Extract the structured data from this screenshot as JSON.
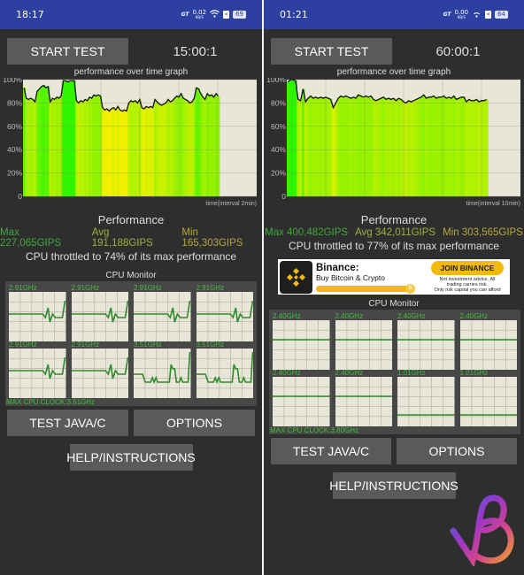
{
  "screens": [
    {
      "status": {
        "time": "18:17",
        "net_speed": "0.02",
        "net_unit": "KB/S",
        "battery": "69"
      },
      "start_label": "START TEST",
      "timer": "15:00:1",
      "graph": {
        "title": "performance over time graph",
        "y_ticks": [
          "100%",
          "80%",
          "60%",
          "40%",
          "20%",
          "0"
        ],
        "x_label": "time(interval 2min)"
      },
      "performance": {
        "title": "Performance",
        "max": "Max 227,065GIPS",
        "avg": "Avg 191,188GIPS",
        "min": "Min 165,303GIPS",
        "throttle": "CPU throttled to 74% of its max performance"
      },
      "cpu_monitor": {
        "title": "CPU Monitor",
        "cores": [
          "2.91GHz",
          "2.91GHz",
          "2.91GHz",
          "2.91GHz",
          "2.91GHz",
          "2.91GHz",
          "3.51GHz",
          "3.51GHz"
        ],
        "max_clock": "MAX CPU CLOCK:3.51GHz"
      },
      "buttons": {
        "test_java": "TEST JAVA/C",
        "options": "OPTIONS",
        "help": "HELP/INSTRUCTIONS"
      }
    },
    {
      "status": {
        "time": "01:21",
        "net_speed": "0.00",
        "net_unit": "KB/S",
        "battery": "64"
      },
      "start_label": "START TEST",
      "timer": "60:00:1",
      "graph": {
        "title": "performance over time graph",
        "y_ticks": [
          "100%",
          "80%",
          "60%",
          "40%",
          "20%",
          "0"
        ],
        "x_label": "time(interval 10min)"
      },
      "performance": {
        "title": "Performance",
        "max": "Max 400,482GIPS",
        "avg": "Avg 342,011GIPS",
        "min": "Min 303,565GIPS",
        "throttle": "CPU throttled to 77% of its max performance"
      },
      "ad": {
        "title": "Binance:",
        "subtitle": "Buy Bitcoin & Crypto",
        "cta": "JOIN BINANCE",
        "disclaimer_1": "Not investment advice. All",
        "disclaimer_2": "trading carries risk.",
        "disclaimer_3": "Only risk capital you can afford"
      },
      "cpu_monitor": {
        "title": "CPU Monitor",
        "cores": [
          "2.40GHz",
          "2.40GHz",
          "2.40GHz",
          "2.40GHz",
          "2.40GHz",
          "2.40GHz",
          "1.01GHz",
          "1.01GHz"
        ],
        "max_clock": "MAX CPU CLOCK:3.80GHz"
      },
      "buttons": {
        "test_java": "TEST JAVA/C",
        "options": "OPTIONS",
        "help": "HELP/INSTRUCTIONS"
      }
    }
  ],
  "colors": {
    "status_bar": "#2d3fa0",
    "background": "#2e2e2e",
    "button": "#5a5a5a",
    "max_green": "#3fa83a",
    "avg_green": "#9ab33a",
    "min_yellow": "#b5a843",
    "core_green": "#3fc03a",
    "ad_yellow": "#f0b90b"
  },
  "chart_data": [
    {
      "type": "area",
      "title": "performance over time graph",
      "xlabel": "time(interval 2min)",
      "ylabel": "",
      "ylim": [
        0,
        100
      ],
      "y_ticks": [
        0,
        20,
        40,
        60,
        80,
        100
      ],
      "x_range_fraction": 0.84,
      "series": [
        {
          "name": "performance %",
          "values": [
            93,
            84,
            83,
            84,
            83,
            81,
            90,
            92,
            94,
            95,
            93,
            94,
            81,
            84,
            83,
            85,
            84,
            86,
            99,
            99,
            98,
            99,
            99,
            99,
            82,
            80,
            82,
            81,
            83,
            82,
            85,
            84,
            87,
            86,
            87,
            86,
            76,
            74,
            75,
            73,
            75,
            76,
            74,
            77,
            74,
            73,
            74,
            73,
            80,
            82,
            81,
            82,
            80,
            83,
            76,
            75,
            77,
            76,
            77,
            76,
            83,
            81,
            79,
            78,
            79,
            80,
            83,
            81,
            82,
            84,
            86,
            85,
            88,
            84,
            83,
            82,
            80,
            81,
            84,
            93,
            92,
            88,
            85,
            83,
            88,
            86,
            87,
            85,
            88,
            86
          ]
        }
      ]
    },
    {
      "type": "area",
      "title": "performance over time graph",
      "xlabel": "time(interval 10min)",
      "ylabel": "",
      "ylim": [
        0,
        100
      ],
      "y_ticks": [
        0,
        20,
        40,
        60,
        80,
        100
      ],
      "x_range_fraction": 0.86,
      "series": [
        {
          "name": "performance %",
          "values": [
            98,
            100,
            100,
            99,
            83,
            82,
            92,
            81,
            84,
            86,
            84,
            85,
            84,
            85,
            84,
            85,
            84,
            83,
            76,
            80,
            84,
            86,
            85,
            86,
            85,
            84,
            85,
            84,
            87,
            86,
            85,
            86,
            85,
            86,
            83,
            82,
            83,
            84,
            85,
            83,
            84,
            83,
            84,
            82,
            84,
            83,
            81,
            80,
            82,
            81,
            82,
            83,
            84,
            85,
            87,
            84,
            85,
            85,
            86,
            84,
            85,
            85,
            86,
            84,
            85,
            84,
            86,
            83,
            84,
            85,
            85,
            81,
            83,
            82,
            82,
            83,
            81,
            82,
            82,
            83
          ]
        }
      ]
    }
  ]
}
